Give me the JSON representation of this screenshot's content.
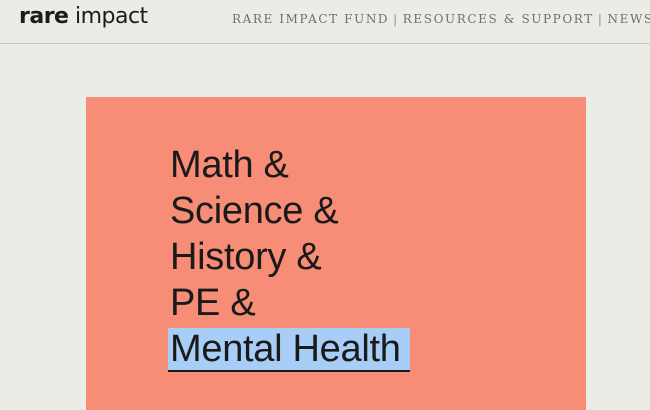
{
  "header": {
    "logo": {
      "part1": "rare",
      "part2": " impact"
    },
    "nav": {
      "items": [
        "RARE IMPACT FUND",
        "RESOURCES & SUPPORT",
        "NEWS"
      ],
      "separator": "|"
    }
  },
  "hero": {
    "background_color": "#f78d76",
    "highlight_color": "#a8cdf6",
    "lines": [
      "Math &",
      "Science &",
      "History &",
      "PE &"
    ],
    "highlight_line": "Mental Health"
  }
}
